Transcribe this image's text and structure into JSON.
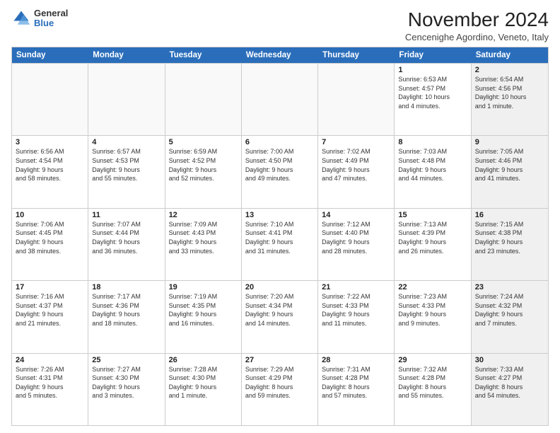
{
  "logo": {
    "general": "General",
    "blue": "Blue"
  },
  "title": "November 2024",
  "location": "Cencenighe Agordino, Veneto, Italy",
  "header_days": [
    "Sunday",
    "Monday",
    "Tuesday",
    "Wednesday",
    "Thursday",
    "Friday",
    "Saturday"
  ],
  "weeks": [
    [
      {
        "day": "",
        "info": "",
        "shaded": true
      },
      {
        "day": "",
        "info": "",
        "shaded": true
      },
      {
        "day": "",
        "info": "",
        "shaded": true
      },
      {
        "day": "",
        "info": "",
        "shaded": true
      },
      {
        "day": "",
        "info": "",
        "shaded": true
      },
      {
        "day": "1",
        "info": "Sunrise: 6:53 AM\nSunset: 4:57 PM\nDaylight: 10 hours\nand 4 minutes.",
        "shaded": false
      },
      {
        "day": "2",
        "info": "Sunrise: 6:54 AM\nSunset: 4:56 PM\nDaylight: 10 hours\nand 1 minute.",
        "shaded": true
      }
    ],
    [
      {
        "day": "3",
        "info": "Sunrise: 6:56 AM\nSunset: 4:54 PM\nDaylight: 9 hours\nand 58 minutes.",
        "shaded": false
      },
      {
        "day": "4",
        "info": "Sunrise: 6:57 AM\nSunset: 4:53 PM\nDaylight: 9 hours\nand 55 minutes.",
        "shaded": false
      },
      {
        "day": "5",
        "info": "Sunrise: 6:59 AM\nSunset: 4:52 PM\nDaylight: 9 hours\nand 52 minutes.",
        "shaded": false
      },
      {
        "day": "6",
        "info": "Sunrise: 7:00 AM\nSunset: 4:50 PM\nDaylight: 9 hours\nand 49 minutes.",
        "shaded": false
      },
      {
        "day": "7",
        "info": "Sunrise: 7:02 AM\nSunset: 4:49 PM\nDaylight: 9 hours\nand 47 minutes.",
        "shaded": false
      },
      {
        "day": "8",
        "info": "Sunrise: 7:03 AM\nSunset: 4:48 PM\nDaylight: 9 hours\nand 44 minutes.",
        "shaded": false
      },
      {
        "day": "9",
        "info": "Sunrise: 7:05 AM\nSunset: 4:46 PM\nDaylight: 9 hours\nand 41 minutes.",
        "shaded": true
      }
    ],
    [
      {
        "day": "10",
        "info": "Sunrise: 7:06 AM\nSunset: 4:45 PM\nDaylight: 9 hours\nand 38 minutes.",
        "shaded": false
      },
      {
        "day": "11",
        "info": "Sunrise: 7:07 AM\nSunset: 4:44 PM\nDaylight: 9 hours\nand 36 minutes.",
        "shaded": false
      },
      {
        "day": "12",
        "info": "Sunrise: 7:09 AM\nSunset: 4:43 PM\nDaylight: 9 hours\nand 33 minutes.",
        "shaded": false
      },
      {
        "day": "13",
        "info": "Sunrise: 7:10 AM\nSunset: 4:41 PM\nDaylight: 9 hours\nand 31 minutes.",
        "shaded": false
      },
      {
        "day": "14",
        "info": "Sunrise: 7:12 AM\nSunset: 4:40 PM\nDaylight: 9 hours\nand 28 minutes.",
        "shaded": false
      },
      {
        "day": "15",
        "info": "Sunrise: 7:13 AM\nSunset: 4:39 PM\nDaylight: 9 hours\nand 26 minutes.",
        "shaded": false
      },
      {
        "day": "16",
        "info": "Sunrise: 7:15 AM\nSunset: 4:38 PM\nDaylight: 9 hours\nand 23 minutes.",
        "shaded": true
      }
    ],
    [
      {
        "day": "17",
        "info": "Sunrise: 7:16 AM\nSunset: 4:37 PM\nDaylight: 9 hours\nand 21 minutes.",
        "shaded": false
      },
      {
        "day": "18",
        "info": "Sunrise: 7:17 AM\nSunset: 4:36 PM\nDaylight: 9 hours\nand 18 minutes.",
        "shaded": false
      },
      {
        "day": "19",
        "info": "Sunrise: 7:19 AM\nSunset: 4:35 PM\nDaylight: 9 hours\nand 16 minutes.",
        "shaded": false
      },
      {
        "day": "20",
        "info": "Sunrise: 7:20 AM\nSunset: 4:34 PM\nDaylight: 9 hours\nand 14 minutes.",
        "shaded": false
      },
      {
        "day": "21",
        "info": "Sunrise: 7:22 AM\nSunset: 4:33 PM\nDaylight: 9 hours\nand 11 minutes.",
        "shaded": false
      },
      {
        "day": "22",
        "info": "Sunrise: 7:23 AM\nSunset: 4:33 PM\nDaylight: 9 hours\nand 9 minutes.",
        "shaded": false
      },
      {
        "day": "23",
        "info": "Sunrise: 7:24 AM\nSunset: 4:32 PM\nDaylight: 9 hours\nand 7 minutes.",
        "shaded": true
      }
    ],
    [
      {
        "day": "24",
        "info": "Sunrise: 7:26 AM\nSunset: 4:31 PM\nDaylight: 9 hours\nand 5 minutes.",
        "shaded": false
      },
      {
        "day": "25",
        "info": "Sunrise: 7:27 AM\nSunset: 4:30 PM\nDaylight: 9 hours\nand 3 minutes.",
        "shaded": false
      },
      {
        "day": "26",
        "info": "Sunrise: 7:28 AM\nSunset: 4:30 PM\nDaylight: 9 hours\nand 1 minute.",
        "shaded": false
      },
      {
        "day": "27",
        "info": "Sunrise: 7:29 AM\nSunset: 4:29 PM\nDaylight: 8 hours\nand 59 minutes.",
        "shaded": false
      },
      {
        "day": "28",
        "info": "Sunrise: 7:31 AM\nSunset: 4:28 PM\nDaylight: 8 hours\nand 57 minutes.",
        "shaded": false
      },
      {
        "day": "29",
        "info": "Sunrise: 7:32 AM\nSunset: 4:28 PM\nDaylight: 8 hours\nand 55 minutes.",
        "shaded": false
      },
      {
        "day": "30",
        "info": "Sunrise: 7:33 AM\nSunset: 4:27 PM\nDaylight: 8 hours\nand 54 minutes.",
        "shaded": true
      }
    ]
  ]
}
